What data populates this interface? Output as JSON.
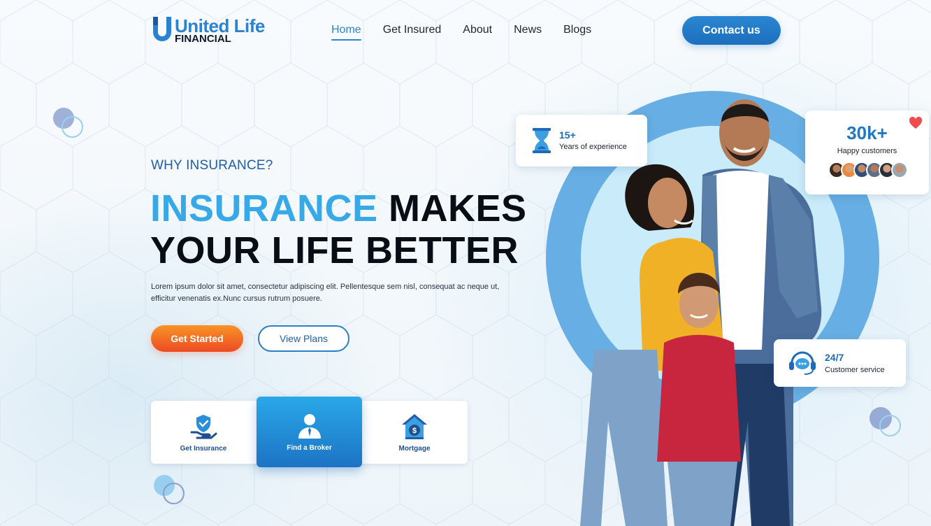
{
  "brand": {
    "name_line1": "United Life",
    "name_line2": "FINANCIAL",
    "mark": "U"
  },
  "nav": {
    "items": [
      {
        "label": "Home",
        "active": true
      },
      {
        "label": "Get Insured",
        "active": false
      },
      {
        "label": "About",
        "active": false
      },
      {
        "label": "News",
        "active": false
      },
      {
        "label": "Blogs",
        "active": false
      }
    ],
    "contact_label": "Contact us"
  },
  "hero": {
    "eyebrow": "WHY INSURANCE?",
    "headline_accent": "INSURANCE",
    "headline_rest1": " MAKES",
    "headline_line2": "YOUR LIFE BETTER",
    "description": "Lorem ipsum dolor sit amet, consectetur adipiscing elit. Pellentesque sem nisl, consequat ac neque ut, efficitur venenatis ex.Nunc cursus rutrum posuere.",
    "primary_cta": "Get Started",
    "secondary_cta": "View Plans"
  },
  "services": [
    {
      "label": "Get Insurance",
      "icon": "shield-hand-icon",
      "active": false
    },
    {
      "label": "Find a Broker",
      "icon": "broker-person-icon",
      "active": true
    },
    {
      "label": "Mortgage",
      "icon": "house-money-icon",
      "active": false
    }
  ],
  "stats": {
    "experience": {
      "value": "15+",
      "label": "Years of experience",
      "icon": "hourglass-icon"
    },
    "customers": {
      "value": "30k+",
      "label": "Happy customers",
      "icon": "heart-icon"
    },
    "support": {
      "value": "24/7",
      "label": "Customer service",
      "icon": "headset-chat-icon"
    }
  },
  "colors": {
    "primary": "#2a86cf",
    "accent_light": "#36a9e6",
    "cta_orange": "#ee4a23",
    "ring": "#66aee3"
  }
}
